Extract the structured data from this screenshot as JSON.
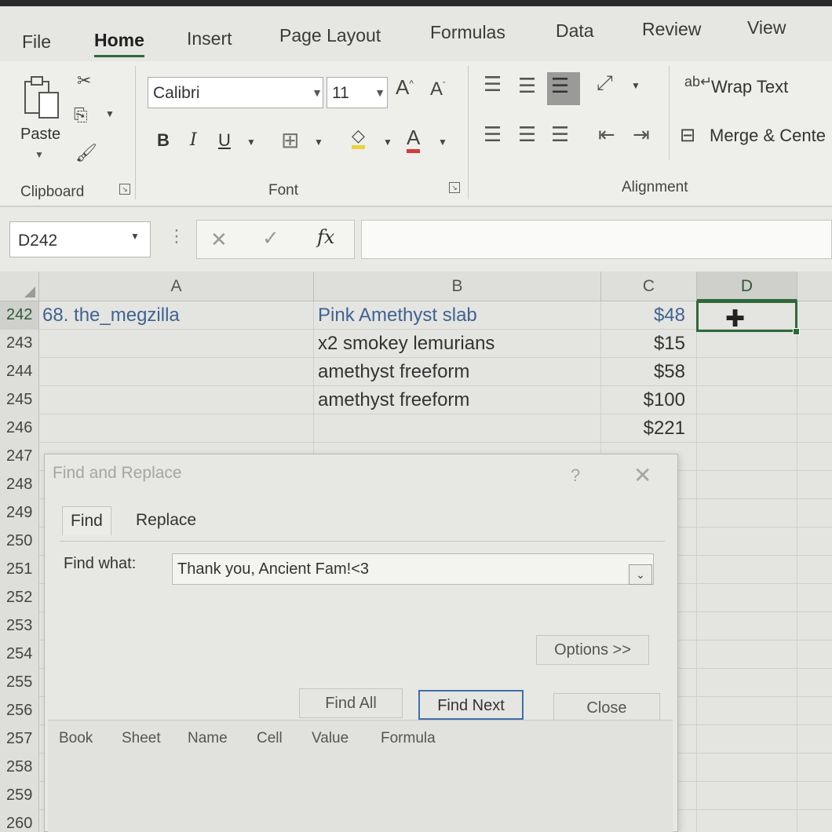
{
  "menu": {
    "tabs": [
      "File",
      "Home",
      "Insert",
      "Page Layout",
      "Formulas",
      "Data",
      "Review",
      "View"
    ],
    "active": "Home"
  },
  "ribbon": {
    "clipboard": {
      "label": "Clipboard",
      "paste_label": "Paste"
    },
    "font": {
      "label": "Font",
      "family": "Calibri",
      "size": "11",
      "bold": "B",
      "italic": "I",
      "underline": "U"
    },
    "alignment": {
      "label": "Alignment",
      "wrap_text": "Wrap Text",
      "merge": "Merge & Cente"
    }
  },
  "formula_bar": {
    "name_box": "D242",
    "fx": "fx",
    "value": ""
  },
  "grid": {
    "columns": [
      "A",
      "B",
      "C",
      "D"
    ],
    "selected_column": "D",
    "rows": [
      {
        "num": "242",
        "a": "68. the_megzilla",
        "b": "Pink Amethyst slab",
        "c": "$48",
        "d": ""
      },
      {
        "num": "243",
        "a": "",
        "b": "x2 smokey lemurians",
        "c": "$15",
        "d": ""
      },
      {
        "num": "244",
        "a": "",
        "b": "amethyst freeform",
        "c": "$58",
        "d": ""
      },
      {
        "num": "245",
        "a": "",
        "b": "amethyst freeform",
        "c": "$100",
        "d": ""
      },
      {
        "num": "246",
        "a": "",
        "b": "",
        "c": "$221",
        "d": ""
      },
      {
        "num": "247"
      },
      {
        "num": "248"
      },
      {
        "num": "249"
      },
      {
        "num": "250"
      },
      {
        "num": "251"
      },
      {
        "num": "252"
      },
      {
        "num": "253"
      },
      {
        "num": "254"
      },
      {
        "num": "255"
      },
      {
        "num": "256"
      },
      {
        "num": "257"
      },
      {
        "num": "258"
      },
      {
        "num": "259"
      },
      {
        "num": "260"
      }
    ]
  },
  "dialog": {
    "title": "Find and Replace",
    "help": "?",
    "tabs": [
      "Find",
      "Replace"
    ],
    "active_tab": "Find",
    "find_what_label": "Find what:",
    "find_what_value": "Thank you, Ancient Fam!<3",
    "options_label": "Options >>",
    "find_all_label": "Find All",
    "find_next_label": "Find Next",
    "close_label": "Close",
    "result_columns": [
      "Book",
      "Sheet",
      "Name",
      "Cell",
      "Value",
      "Formula"
    ]
  }
}
